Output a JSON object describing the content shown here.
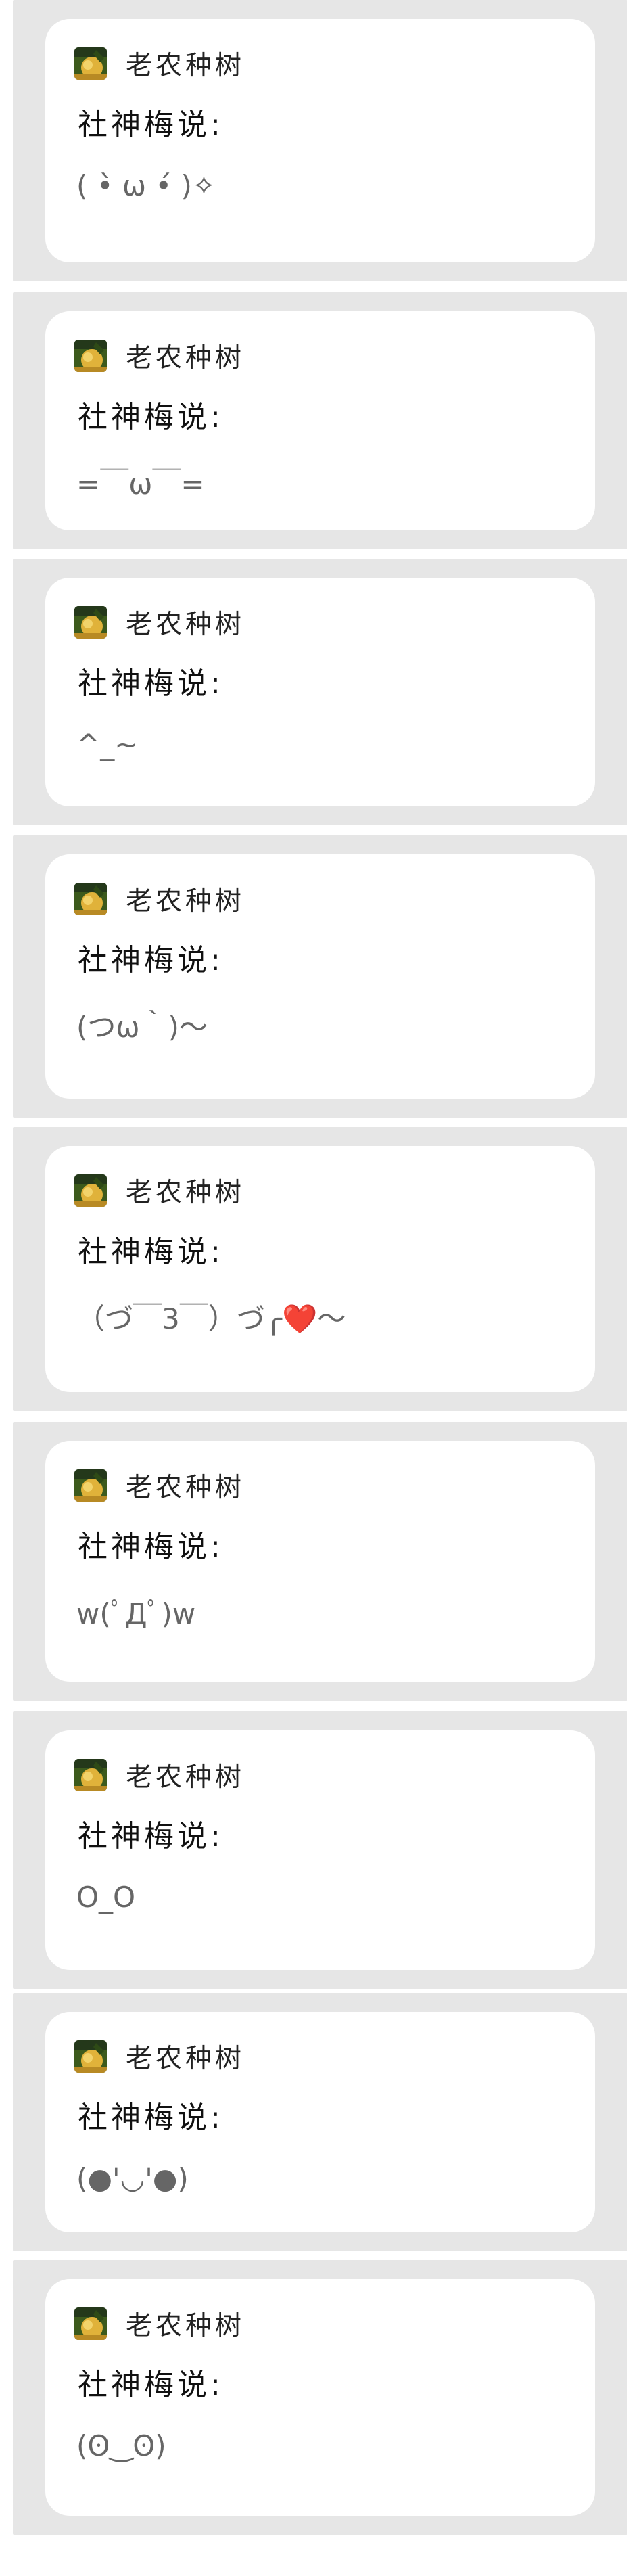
{
  "posts": [
    {
      "username": "老农种树",
      "speaker": "社神梅说:",
      "emote": "( •̀ ω •́ )✧"
    },
    {
      "username": "老农种树",
      "speaker": "社神梅说:",
      "emote": "=￣ω￣="
    },
    {
      "username": "老农种树",
      "speaker": "社神梅说:",
      "emote": "^_~"
    },
    {
      "username": "老农种树",
      "speaker": "社神梅说:",
      "emote": "(つω｀)～"
    },
    {
      "username": "老农种树",
      "speaker": "社神梅说:",
      "emote": "（づ￣3￣）づ╭❤️～"
    },
    {
      "username": "老农种树",
      "speaker": "社神梅说:",
      "emote": "w(ﾟДﾟ)w"
    },
    {
      "username": "老农种树",
      "speaker": "社神梅说:",
      "emote": "O_O"
    },
    {
      "username": "老农种树",
      "speaker": "社神梅说:",
      "emote": "(●'◡'●)"
    },
    {
      "username": "老农种树",
      "speaker": "社神梅说:",
      "emote": "(ʘ‿ʘ)"
    }
  ]
}
